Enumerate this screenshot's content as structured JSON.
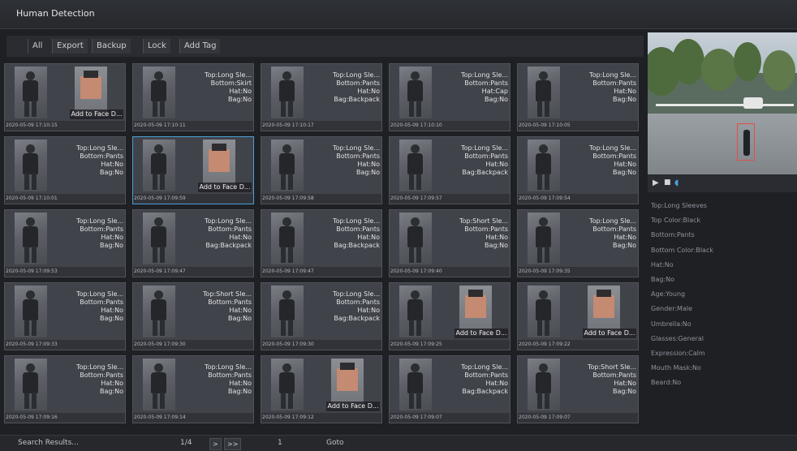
{
  "window": {
    "title": "Human Detection"
  },
  "toolbar": {
    "all": "All",
    "export": "Export",
    "backup": "Backup",
    "lock": "Lock",
    "add_tag": "Add Tag"
  },
  "add_to_face_label": "Add to Face D...",
  "results": [
    {
      "attrs": [],
      "time": "2020-05-09 17:10:15",
      "face": true
    },
    {
      "attrs": [
        "Top:Long Sle...",
        "Bottom:Skirt",
        "Hat:No",
        "Bag:No"
      ],
      "time": "2020-05-09 17:10:11"
    },
    {
      "attrs": [
        "Top:Long Sle...",
        "Bottom:Pants",
        "Hat:No",
        "Bag:Backpack"
      ],
      "time": "2020-05-09 17:10:17"
    },
    {
      "attrs": [
        "Top:Long Sle...",
        "Bottom:Pants",
        "Hat:Cap",
        "Bag:No"
      ],
      "time": "2020-05-09 17:10:10"
    },
    {
      "attrs": [
        "Top:Long Sle...",
        "Bottom:Pants",
        "Hat:No",
        "Bag:No"
      ],
      "time": "2020-05-09 17:10:05"
    },
    {
      "attrs": [
        "Top:Long Sle...",
        "Bottom:Pants",
        "Hat:No",
        "Bag:No"
      ],
      "time": "2020-05-09 17:10:01"
    },
    {
      "attrs": [],
      "time": "2020-05-09 17:09:59",
      "face": true,
      "selected": true
    },
    {
      "attrs": [
        "Top:Long Sle...",
        "Bottom:Pants",
        "Hat:No",
        "Bag:No"
      ],
      "time": "2020-05-09 17:09:58"
    },
    {
      "attrs": [
        "Top:Long Sle...",
        "Bottom:Pants",
        "Hat:No",
        "Bag:Backpack"
      ],
      "time": "2020-05-09 17:09:57"
    },
    {
      "attrs": [
        "Top:Long Sle...",
        "Bottom:Pants",
        "Hat:No",
        "Bag:No"
      ],
      "time": "2020-05-09 17:09:54"
    },
    {
      "attrs": [
        "Top:Long Sle...",
        "Bottom:Pants",
        "Hat:No",
        "Bag:No"
      ],
      "time": "2020-05-09 17:09:53"
    },
    {
      "attrs": [
        "Top:Long Sle...",
        "Bottom:Pants",
        "Hat:No",
        "Bag:Backpack"
      ],
      "time": "2020-05-09 17:09:47"
    },
    {
      "attrs": [
        "Top:Long Sle...",
        "Bottom:Pants",
        "Hat:No",
        "Bag:Backpack"
      ],
      "time": "2020-05-09 17:09:47"
    },
    {
      "attrs": [
        "Top:Short Sle...",
        "Bottom:Pants",
        "Hat:No",
        "Bag:No"
      ],
      "time": "2020-05-09 17:09:40"
    },
    {
      "attrs": [
        "Top:Long Sle...",
        "Bottom:Pants",
        "Hat:No",
        "Bag:No"
      ],
      "time": "2020-05-09 17:09:35"
    },
    {
      "attrs": [
        "Top:Long Sle...",
        "Bottom:Pants",
        "Hat:No",
        "Bag:No"
      ],
      "time": "2020-05-09 17:09:33"
    },
    {
      "attrs": [
        "Top:Short Sle...",
        "Bottom:Pants",
        "Hat:No",
        "Bag:No"
      ],
      "time": "2020-05-09 17:09:30"
    },
    {
      "attrs": [
        "Top:Long Sle...",
        "Bottom:Pants",
        "Hat:No",
        "Bag:Backpack"
      ],
      "time": "2020-05-09 17:09:30"
    },
    {
      "attrs": [],
      "time": "2020-05-09 17:09:25",
      "face": true
    },
    {
      "attrs": [],
      "time": "2020-05-09 17:09:22",
      "face": true
    },
    {
      "attrs": [
        "Top:Long Sle...",
        "Bottom:Pants",
        "Hat:No",
        "Bag:No"
      ],
      "time": "2020-05-09 17:09:16"
    },
    {
      "attrs": [
        "Top:Long Sle...",
        "Bottom:Pants",
        "Hat:No",
        "Bag:No"
      ],
      "time": "2020-05-09 17:09:14"
    },
    {
      "attrs": [],
      "time": "2020-05-09 17:09:12",
      "face": true
    },
    {
      "attrs": [
        "Top:Long Sle...",
        "Bottom:Pants",
        "Hat:No",
        "Bag:Backpack"
      ],
      "time": "2020-05-09 17:09:07"
    },
    {
      "attrs": [
        "Top:Short Sle...",
        "Bottom:Pants",
        "Hat:No",
        "Bag:No"
      ],
      "time": "2020-05-09 17:09:07"
    }
  ],
  "details": [
    "Top:Long Sleeves",
    "Top Color:Black",
    "Bottom:Pants",
    "Bottom Color:Black",
    "Hat:No",
    "Bag:No",
    "Age:Young",
    "Gender:Male",
    "Umbrella:No",
    "Glasses:General",
    "Expression:Calm",
    "Mouth Mask:No",
    "Beard:No"
  ],
  "status": {
    "label": "Search Results...",
    "page": "1/4",
    "next": ">",
    "last": ">>",
    "goto_value": "1",
    "goto": "Goto"
  }
}
